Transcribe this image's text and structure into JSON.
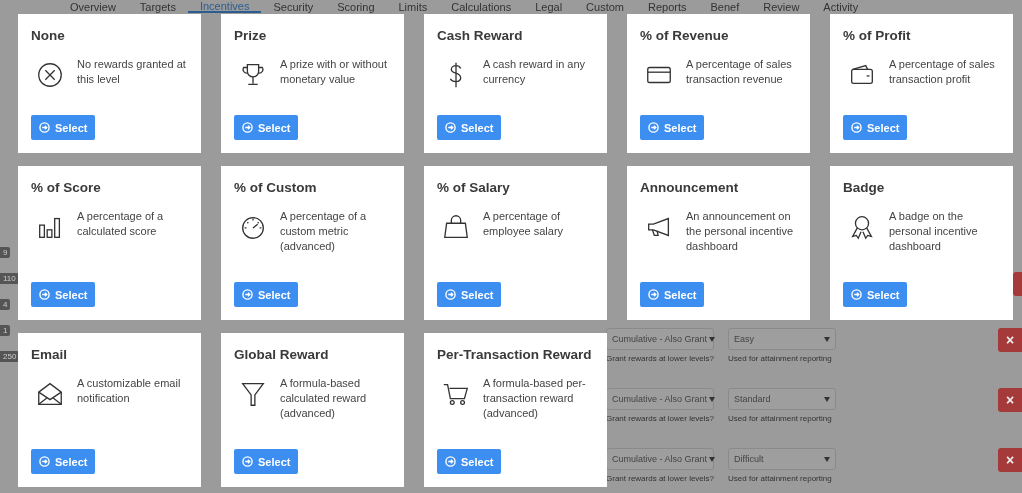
{
  "tabs": [
    {
      "label": "Overview",
      "selected": false
    },
    {
      "label": "Targets",
      "selected": false
    },
    {
      "label": "Incentives",
      "selected": true
    },
    {
      "label": "Security",
      "selected": false
    },
    {
      "label": "Scoring",
      "selected": false
    },
    {
      "label": "Limits",
      "selected": false
    },
    {
      "label": "Calculations",
      "selected": false
    },
    {
      "label": "Legal",
      "selected": false
    },
    {
      "label": "Custom",
      "selected": false
    },
    {
      "label": "Reports",
      "selected": false
    },
    {
      "label": "Benef",
      "selected": false
    },
    {
      "label": "Review",
      "selected": false
    },
    {
      "label": "Activity",
      "selected": false
    }
  ],
  "level_badges": [
    "9",
    "110",
    "4",
    "1",
    "250"
  ],
  "level_rows": [
    {
      "kind": "hidden"
    },
    {
      "kind": "full",
      "grant_mode": "Cumulative - Also Grant",
      "grant_hint": "Grant rewards at lower levels?",
      "difficulty": "Easy",
      "difficulty_hint": "Used for attainment reporting",
      "delete": "×"
    },
    {
      "kind": "full",
      "grant_mode": "Cumulative - Also Grant",
      "grant_hint": "Grant rewards at lower levels?",
      "difficulty": "Standard",
      "difficulty_hint": "Used for attainment reporting",
      "delete": "×"
    },
    {
      "kind": "full",
      "grant_mode": "Cumulative - Also Grant",
      "grant_hint": "Grant rewards at lower levels?",
      "difficulty": "Difficult",
      "difficulty_hint": "Used for attainment reporting",
      "delete": "×"
    }
  ],
  "reward_types": [
    {
      "kind": "none",
      "title": "None",
      "description": "No rewards granted at this level",
      "button": "Select"
    },
    {
      "kind": "prize",
      "title": "Prize",
      "description": "A prize with or without monetary value",
      "button": "Select"
    },
    {
      "kind": "cash",
      "title": "Cash Reward",
      "description": "A cash reward in any currency",
      "button": "Select"
    },
    {
      "kind": "revenue",
      "title": "% of Revenue",
      "description": "A percentage of sales transaction revenue",
      "button": "Select"
    },
    {
      "kind": "profit",
      "title": "% of Profit",
      "description": "A percentage of sales transaction profit",
      "button": "Select"
    },
    {
      "kind": "score",
      "title": "% of Score",
      "description": "A percentage of a calculated score",
      "button": "Select"
    },
    {
      "kind": "custom",
      "title": "% of Custom",
      "description": "A percentage of a custom metric (advanced)",
      "button": "Select"
    },
    {
      "kind": "salary",
      "title": "% of Salary",
      "description": "A percentage of employee salary",
      "button": "Select"
    },
    {
      "kind": "announcement",
      "title": "Announcement",
      "description": "An announcement on the personal incentive dashboard",
      "button": "Select"
    },
    {
      "kind": "badge",
      "title": "Badge",
      "description": "A badge on the personal incentive dashboard",
      "button": "Select"
    },
    {
      "kind": "email",
      "title": "Email",
      "description": "A customizable email notification",
      "button": "Select"
    },
    {
      "kind": "global",
      "title": "Global Reward",
      "description": "A formula-based calculated reward (advanced)",
      "button": "Select"
    },
    {
      "kind": "transaction",
      "title": "Per-Transaction Reward",
      "description": "A formula-based per-transaction reward (advanced)",
      "button": "Select"
    }
  ]
}
